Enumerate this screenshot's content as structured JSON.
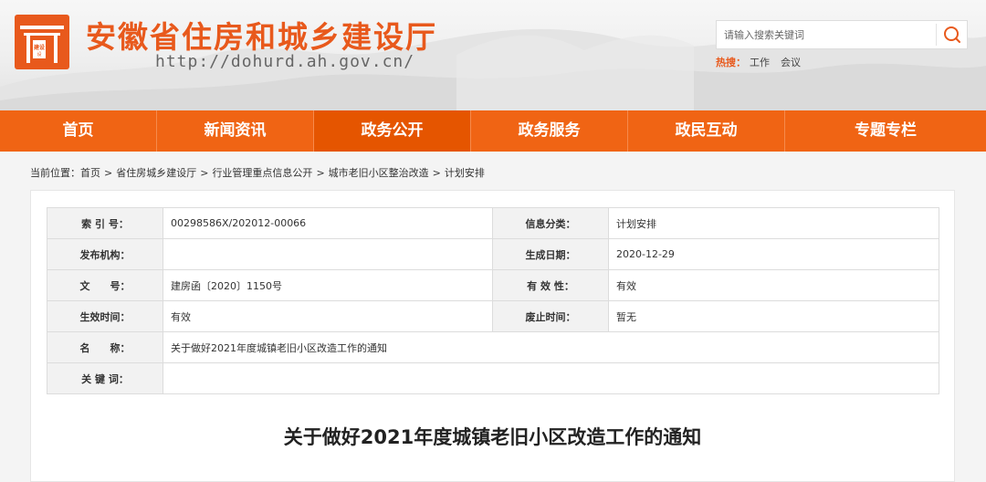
{
  "header": {
    "site_title": "安徽省住房和城乡建设厅",
    "site_url": "http://dohurd.ah.gov.cn/",
    "logo_text": "建设",
    "search_placeholder": "请输入搜索关键词",
    "hot_label": "热搜：",
    "hot_items": [
      "工作",
      "会议"
    ],
    "brand_color": "#e8591c"
  },
  "nav": {
    "items": [
      "首页",
      "新闻资讯",
      "政务公开",
      "政务服务",
      "政民互动",
      "专题专栏"
    ],
    "active": "政务公开"
  },
  "breadcrumb": {
    "label": "当前位置：",
    "items": [
      "首页",
      "省住房城乡建设厅",
      "行业管理重点信息公开",
      "城市老旧小区整治改造",
      "计划安排"
    ],
    "separator": ">"
  },
  "meta": {
    "index_label": "索 引 号：",
    "index_value": "00298586X/202012-00066",
    "category_label": "信息分类：",
    "category_value": "计划安排",
    "publisher_label": "发布机构：",
    "publisher_value": "",
    "date_label": "生成日期：",
    "date_value": "2020-12-29",
    "docno_label": "文　　号：",
    "docno_value": "建房函〔2020〕1150号",
    "validity_label": "有 效 性：",
    "validity_value": "有效",
    "effective_label": "生效时间：",
    "effective_value": "有效",
    "expire_label": "废止时间：",
    "expire_value": "暂无",
    "name_label": "名　　称：",
    "name_value": "关于做好2021年度城镇老旧小区改造工作的通知",
    "keywords_label": "关 键 词：",
    "keywords_value": ""
  },
  "document": {
    "title": "关于做好2021年度城镇老旧小区改造工作的通知"
  }
}
